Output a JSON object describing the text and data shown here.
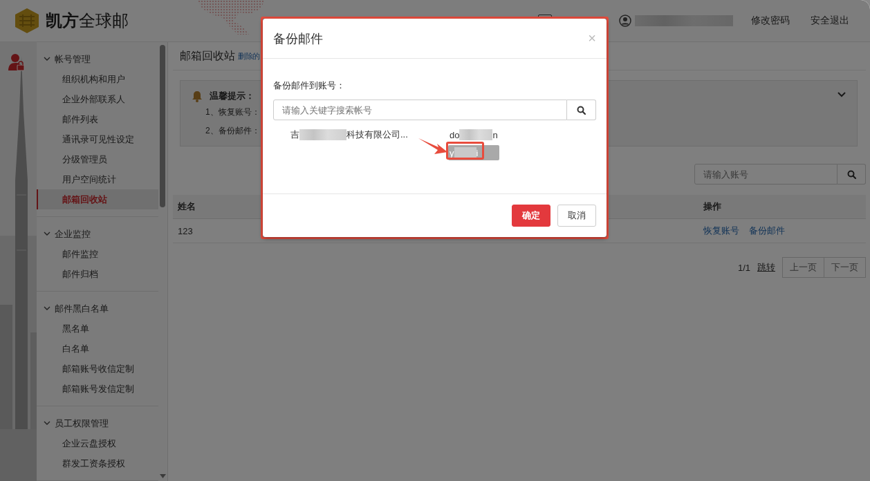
{
  "header": {
    "logo_bold": "凯方",
    "logo_rest": "全球邮",
    "links": [
      "修改密码",
      "安全退出"
    ]
  },
  "sidebar": {
    "groups": [
      {
        "label": "帐号管理",
        "expanded": true,
        "items": [
          {
            "label": "组织机构和用户",
            "selected": false
          },
          {
            "label": "企业外部联系人",
            "selected": false
          },
          {
            "label": "邮件列表",
            "selected": false
          },
          {
            "label": "通讯录可见性设定",
            "selected": false
          },
          {
            "label": "分级管理员",
            "selected": false
          },
          {
            "label": "用户空间统计",
            "selected": false
          },
          {
            "label": "邮箱回收站",
            "selected": true
          }
        ]
      },
      {
        "label": "企业监控",
        "expanded": true,
        "items": [
          {
            "label": "邮件监控",
            "selected": false
          },
          {
            "label": "邮件归档",
            "selected": false
          }
        ]
      },
      {
        "label": "邮件黑白名单",
        "expanded": true,
        "items": [
          {
            "label": "黑名单",
            "selected": false
          },
          {
            "label": "白名单",
            "selected": false
          },
          {
            "label": "邮箱账号收信定制",
            "selected": false
          },
          {
            "label": "邮箱账号发信定制",
            "selected": false
          }
        ]
      },
      {
        "label": "员工权限管理",
        "expanded": true,
        "items": [
          {
            "label": "企业云盘授权",
            "selected": false
          },
          {
            "label": "群发工资条授权",
            "selected": false
          }
        ]
      }
    ]
  },
  "page": {
    "title": "邮箱回收站",
    "subtitle": "删除的",
    "tips": {
      "title": "温馨提示：",
      "lines": [
        "1、恢复账号：",
        "2、备份邮件："
      ]
    },
    "search": {
      "placeholder": "请输入账号"
    },
    "table": {
      "columns": [
        "姓名",
        "操作"
      ],
      "rows": [
        {
          "name": "123",
          "actions": [
            "恢复账号",
            "备份邮件"
          ]
        }
      ]
    },
    "pagination": {
      "page": "1/1",
      "jump": "跳转",
      "prev": "上一页",
      "next": "下一页"
    }
  },
  "modal": {
    "title": "备份邮件",
    "close": "×",
    "label": "备份邮件到账号：",
    "search": {
      "placeholder": "请输入关键字搜索帐号"
    },
    "results": [
      {
        "company_start": "吉",
        "company_end": "科技有限公司...",
        "accounts": [
          {
            "start": "do",
            "end": "n",
            "selected": false
          },
          {
            "start": "y",
            "end": "i",
            "selected": true
          }
        ]
      }
    ],
    "buttons": [
      "确定",
      "取消"
    ]
  }
}
